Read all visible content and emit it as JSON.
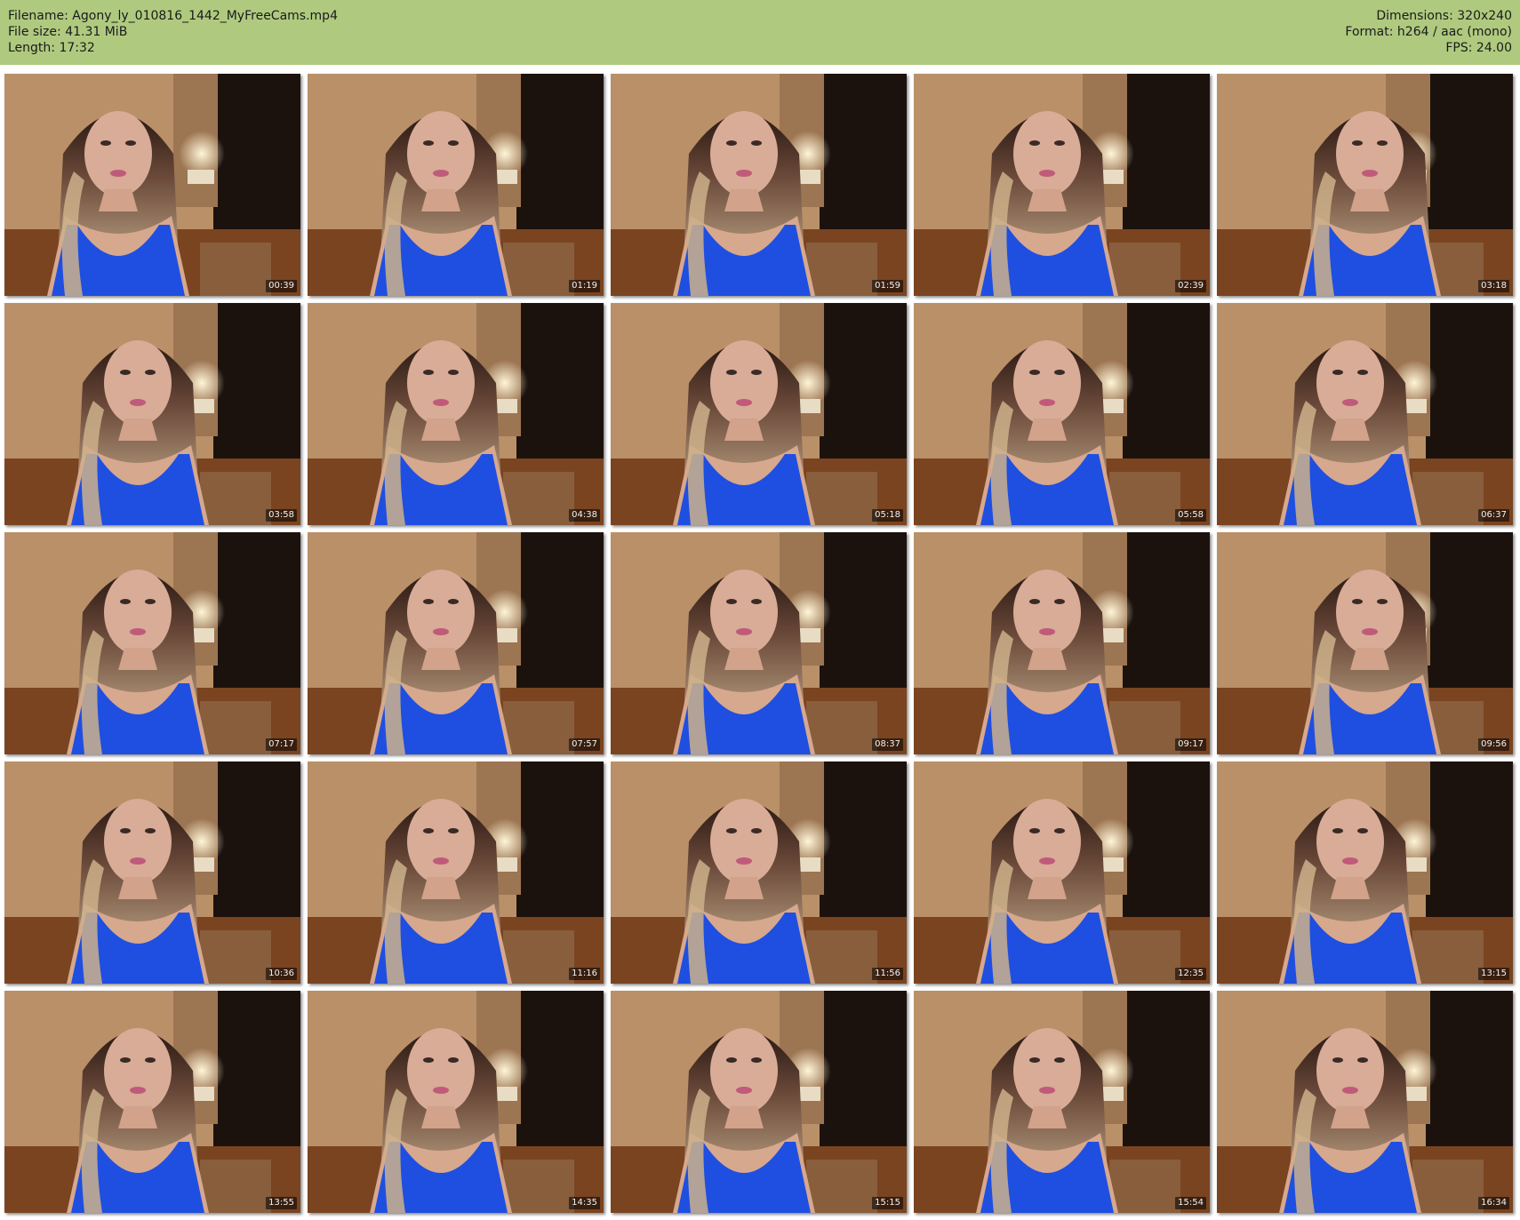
{
  "header": {
    "filename": "Filename: Agony_ly_010816_1442_MyFreeCams.mp4",
    "file_size": "File size: 41.31 MiB",
    "length": "Length: 17:32",
    "dimensions": "Dimensions: 320x240",
    "format": "Format: h264 / aac (mono)",
    "fps": "FPS: 24.00"
  },
  "colors": {
    "header_bg": "#afca7f",
    "tank_top": "#1f4fe0",
    "wall": "#b99068",
    "floor": "#7a4420"
  },
  "thumbnails": [
    {
      "time": "00:39",
      "pose": "left"
    },
    {
      "time": "01:19",
      "pose": "center"
    },
    {
      "time": "01:59",
      "pose": "center"
    },
    {
      "time": "02:39",
      "pose": "center"
    },
    {
      "time": "03:18",
      "pose": "right"
    },
    {
      "time": "03:58",
      "pose": "center"
    },
    {
      "time": "04:38",
      "pose": "center"
    },
    {
      "time": "05:18",
      "pose": "center"
    },
    {
      "time": "05:58",
      "pose": "center"
    },
    {
      "time": "06:37",
      "pose": "center"
    },
    {
      "time": "07:17",
      "pose": "center"
    },
    {
      "time": "07:57",
      "pose": "center"
    },
    {
      "time": "08:37",
      "pose": "center"
    },
    {
      "time": "09:17",
      "pose": "center"
    },
    {
      "time": "09:56",
      "pose": "right"
    },
    {
      "time": "10:36",
      "pose": "center"
    },
    {
      "time": "11:16",
      "pose": "center"
    },
    {
      "time": "11:56",
      "pose": "center"
    },
    {
      "time": "12:35",
      "pose": "center"
    },
    {
      "time": "13:15",
      "pose": "center"
    },
    {
      "time": "13:55",
      "pose": "center"
    },
    {
      "time": "14:35",
      "pose": "center"
    },
    {
      "time": "15:15",
      "pose": "center"
    },
    {
      "time": "15:54",
      "pose": "center"
    },
    {
      "time": "16:34",
      "pose": "center"
    }
  ]
}
